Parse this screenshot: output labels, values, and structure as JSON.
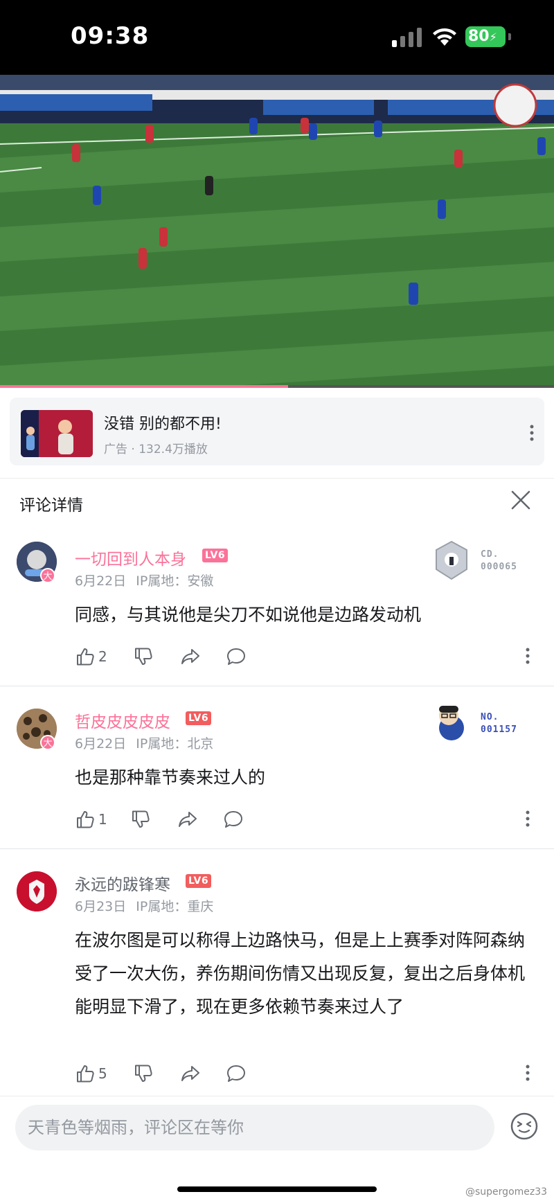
{
  "status_bar": {
    "time": "09:38",
    "battery": "80"
  },
  "video": {
    "progress_fraction": 0.52
  },
  "ad": {
    "title": "没错 别的都不用!",
    "subtitle": "广告 · 132.4万播放"
  },
  "comment_detail": {
    "title": "评论详情"
  },
  "comments": [
    {
      "username": "一切回到人本身",
      "username_color": "#fb7299",
      "level": "LV6",
      "level_color": "#fb7299",
      "badge": "大",
      "date": "6月22日",
      "ip_label": "IP属地：安徽",
      "content": "同感，与其说他是尖刀不如说他是边路发动机",
      "likes": "2",
      "fan_label_1": "CD.",
      "fan_label_2": "000065",
      "fan_color": "#9aa0a8"
    },
    {
      "username": "哲皮皮皮皮皮",
      "username_color": "#fb7299",
      "level": "LV6",
      "level_color": "#f25d5d",
      "badge": "大",
      "date": "6月22日",
      "ip_label": "IP属地：北京",
      "content": "也是那种靠节奏来过人的",
      "likes": "1",
      "fan_label_1": "NO.",
      "fan_label_2": "001157",
      "fan_color": "#3a4fb5"
    },
    {
      "username": "永远的跋锋寒",
      "username_color": "#61666d",
      "level": "LV6",
      "level_color": "#f25d5d",
      "date": "6月23日",
      "ip_label": "IP属地：重庆",
      "content": "在波尔图是可以称得上边路快马，但是上上赛季对阵阿森纳受了一次大伤，养伤期间伤情又出现反复，复出之后身体机能明显下滑了，现在更多依赖节奏来过人了",
      "likes": "5"
    }
  ],
  "input": {
    "placeholder": "天青色等烟雨，评论区在等你"
  },
  "watermark": "@supergomez33",
  "icons": [
    "signal-icon",
    "wifi-icon",
    "battery-icon",
    "more-vertical-icon",
    "close-icon",
    "thumb-up-icon",
    "thumb-down-icon",
    "share-icon",
    "reply-icon",
    "emoji-icon"
  ],
  "colors": {
    "accent": "#fb7299",
    "meta": "#9499a0",
    "pitch": "#2f6a34"
  }
}
